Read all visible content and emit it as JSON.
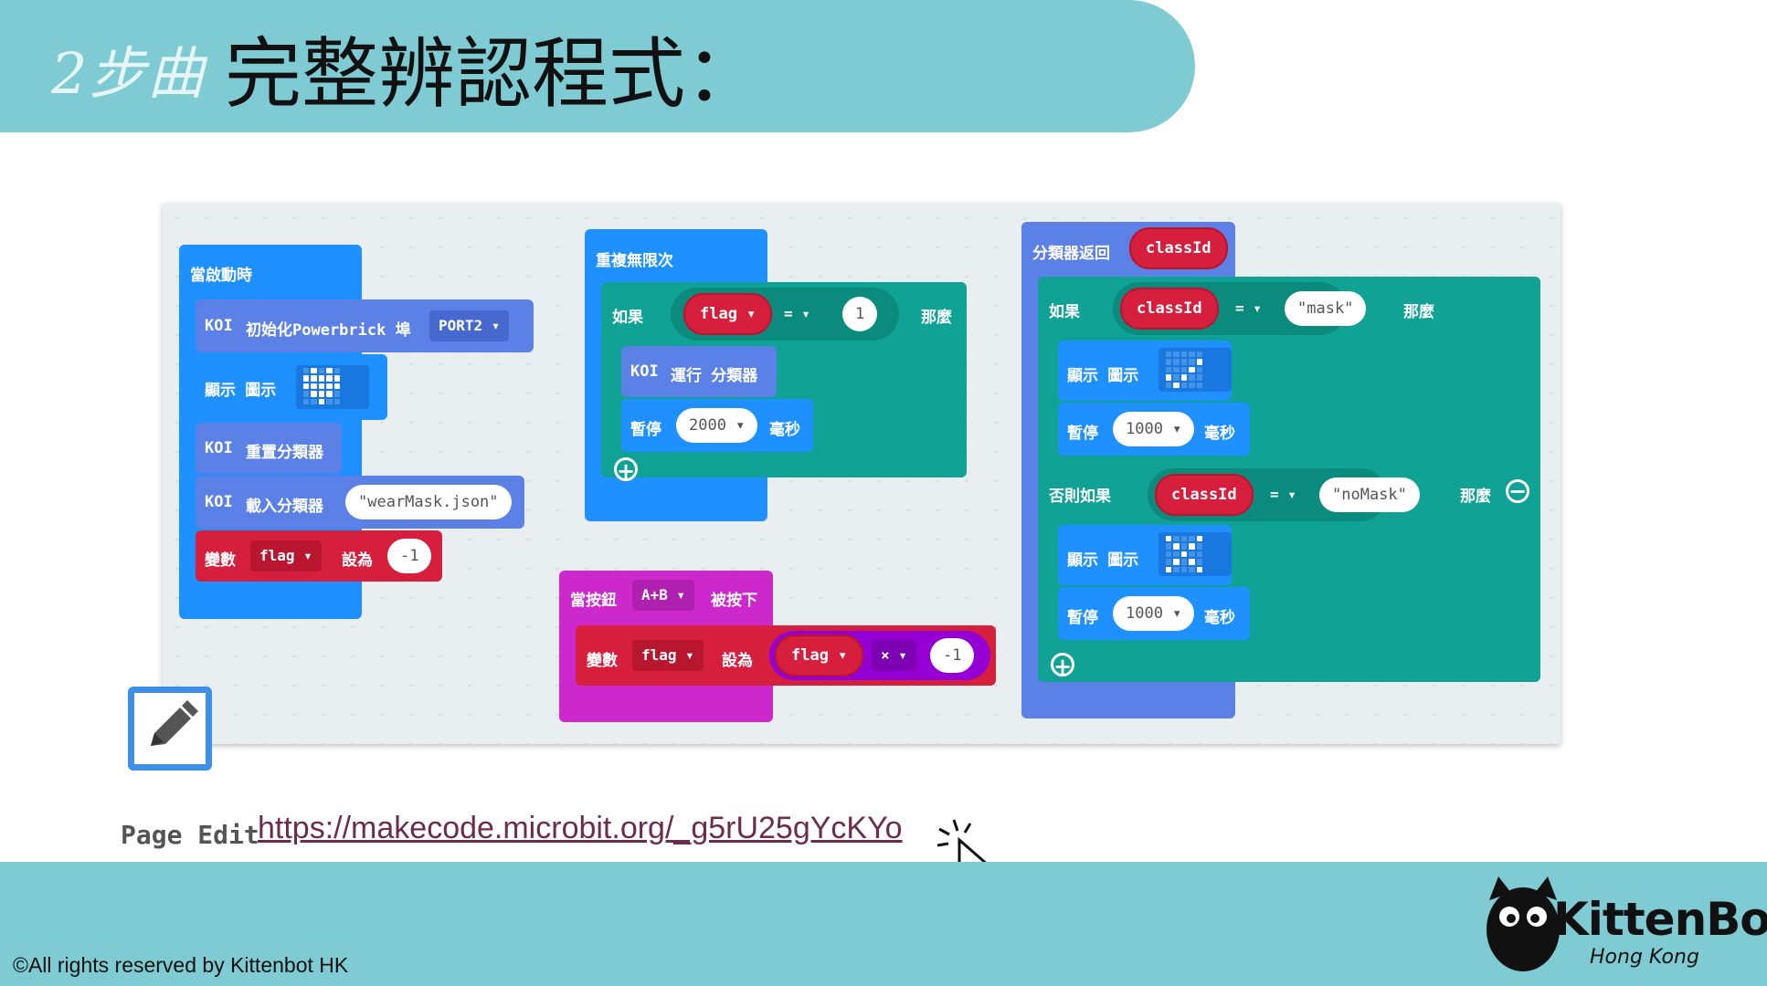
{
  "header": {
    "step": "2步曲",
    "title": "完整辨認程式："
  },
  "blocks": {
    "on_start": {
      "hat": "當啟動時",
      "init_prefix": "KOI",
      "init_label": "初始化Powerbrick 埠",
      "init_port": "PORT2 ▾",
      "show_label": "顯示 圖示",
      "reset_prefix": "KOI",
      "reset_label": "重置分類器",
      "load_prefix": "KOI",
      "load_label": "載入分類器",
      "load_file": "\"wearMask.json\"",
      "var_label": "變數",
      "var_name": "flag ▾",
      "var_set": "設為",
      "var_value": "-1"
    },
    "forever": {
      "hat": "重複無限次",
      "if_label": "如果",
      "cond_var": "flag ▾",
      "cond_op": "= ▾",
      "cond_value": "1",
      "then_label": "那麼",
      "run_prefix": "KOI",
      "run_label": "運行 分類器",
      "pause_label": "暫停",
      "pause_value": "2000 ▾",
      "pause_unit": "毫秒"
    },
    "on_button": {
      "hat": "當按鈕",
      "button": "A+B ▾",
      "pressed": "被按下",
      "var_label": "變數",
      "var_name": "flag ▾",
      "var_set": "設為",
      "expr_var": "flag ▾",
      "expr_op": "× ▾",
      "expr_value": "-1"
    },
    "classifier": {
      "hat": "分類器返回",
      "hat_var": "classId",
      "if_label": "如果",
      "cond1_var": "classId",
      "cond1_op": "= ▾",
      "cond1_value": "\"mask\"",
      "then_label": "那麼",
      "show1_label": "顯示 圖示",
      "pause1_label": "暫停",
      "pause1_value": "1000 ▾",
      "pause1_unit": "毫秒",
      "elseif_label": "否則如果",
      "cond2_var": "classId",
      "cond2_op": "= ▾",
      "cond2_value": "\"noMask\"",
      "then2_label": "那麼",
      "show2_label": "顯示 圖示",
      "pause2_label": "暫停",
      "pause2_value": "1000 ▾",
      "pause2_unit": "毫秒"
    }
  },
  "page_edit": {
    "label": "Page Edit",
    "link": "https://makecode.microbit.org/_g5rU25gYcKYo"
  },
  "footer": {
    "copyright": "©All rights reserved by Kittenbot HK",
    "brand": "KittenBot",
    "brand_sub": "Hong Kong"
  },
  "colors": {
    "band": "#7ecbd4",
    "basic_blue": "#1e90ff",
    "koi_blue": "#5b80e6",
    "variable_red": "#d61f3c",
    "logic_teal": "#0fa295",
    "input_magenta": "#cc28cc",
    "math_purple": "#9400d3",
    "link": "#6b2d4d"
  },
  "icons": {
    "edit": "pencil-edit-icon",
    "cursor": "click-cursor-icon",
    "heart": "heart-matrix-icon",
    "check": "check-matrix-icon",
    "cross": "cross-matrix-icon",
    "add": "plus-circle-icon",
    "remove": "minus-circle-icon"
  }
}
